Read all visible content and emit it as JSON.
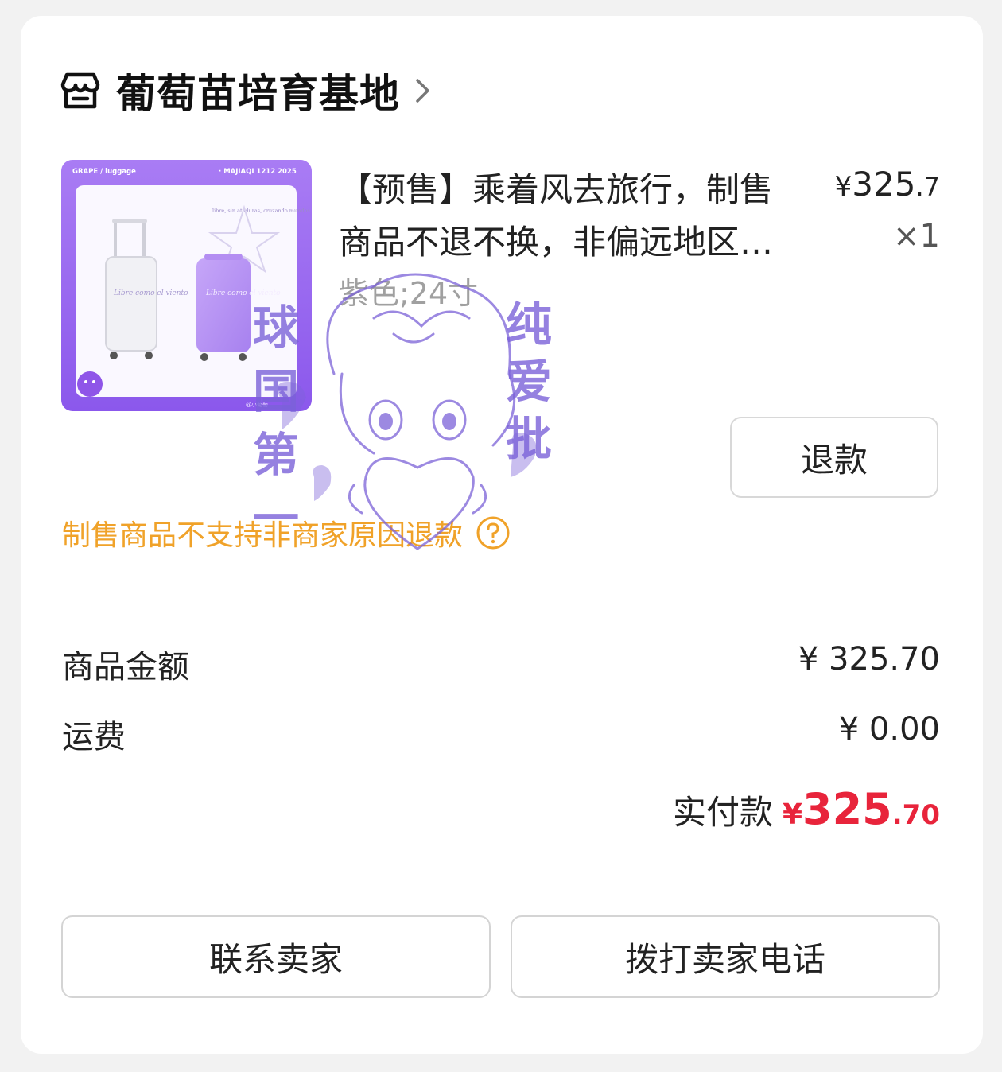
{
  "shop": {
    "name": "葡萄苗培育基地"
  },
  "product": {
    "thumbnail": {
      "label_left": "GRAPE / luggage",
      "label_right": "· MAJIAQI 1212  2025",
      "caption": "libre, sin ataduras, cruzando mundos",
      "case_text_1": "Libre como el viento",
      "case_text_2": "Libre como el viento",
      "credit": "@小葡萄"
    },
    "title": "【预售】乘着风去旅行，制售商品不退不换，非偏远地区包邮",
    "price_currency": "¥",
    "price_int": "325",
    "price_dec": ".7",
    "quantity": "×1",
    "spec": "紫色;24寸"
  },
  "actions": {
    "refund_label": "退款",
    "contact_label": "联系卖家",
    "call_label": "拨打卖家电话"
  },
  "notice": {
    "text": "制售商品不支持非商家原因退款"
  },
  "summary": {
    "goods_label": "商品金额",
    "goods_value": "¥ 325.70",
    "shipping_label": "运费",
    "shipping_value": "¥ 0.00",
    "paid_label": "实付款",
    "paid_currency": "¥",
    "paid_int": "325",
    "paid_dec": ".70"
  },
  "watermark": {
    "left_text": "球国第一",
    "right_text": "纯爱批"
  },
  "colors": {
    "accent_red": "#e8243b",
    "notice_orange": "#f0a229",
    "thumb_purple": "#9b6df0",
    "watermark_purple": "#7b62d8"
  },
  "icons": {
    "shop": "store-icon",
    "chevron": "chevron-right-icon",
    "help": "question-circle-icon"
  }
}
